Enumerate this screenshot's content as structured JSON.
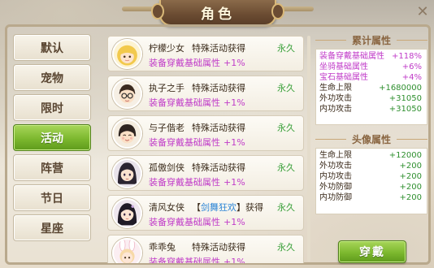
{
  "window": {
    "title": "角色"
  },
  "tabs": [
    {
      "label": "默认"
    },
    {
      "label": "宠物"
    },
    {
      "label": "限时"
    },
    {
      "label": "活动",
      "active": true
    },
    {
      "label": "阵营"
    },
    {
      "label": "节日"
    },
    {
      "label": "星座"
    }
  ],
  "titles": [
    {
      "name": "柠檬少女",
      "method": "特殊活动获得",
      "duration": "永久",
      "effect": "装备穿戴基础属性",
      "value": "+1%"
    },
    {
      "name": "执子之手",
      "method": "特殊活动获得",
      "duration": "永久",
      "effect": "装备穿戴基础属性",
      "value": "+1%"
    },
    {
      "name": "与子偕老",
      "method": "特殊活动获得",
      "duration": "永久",
      "effect": "装备穿戴基础属性",
      "value": "+1%"
    },
    {
      "name": "孤傲剑侠",
      "method": "特殊活动获得",
      "duration": "永久",
      "effect": "装备穿戴基础属性",
      "value": "+1%"
    },
    {
      "name": "清风女侠",
      "method_prefix": "【",
      "method_highlight": "剑舞狂欢",
      "method_suffix": "】获得",
      "duration": "永久",
      "effect": "装备穿戴基础属性",
      "value": "+1%"
    },
    {
      "name": "乖乖兔",
      "method": "特殊活动获得",
      "duration": "永久",
      "effect": "装备穿戴基础属性",
      "value": "+1%"
    }
  ],
  "accumulated": {
    "heading": "累计属性",
    "stats": [
      {
        "label": "装备穿戴基础属性",
        "value": "+118%",
        "color": "purple"
      },
      {
        "label": "坐骑基础属性",
        "value": "+6%",
        "color": "purple"
      },
      {
        "label": "宝石基础属性",
        "value": "+4%",
        "color": "purple"
      },
      {
        "label": "生命上限",
        "value": "+1680000"
      },
      {
        "label": "外功攻击",
        "value": "+31050"
      },
      {
        "label": "内功攻击",
        "value": "+31050"
      }
    ]
  },
  "avatar_attrs": {
    "heading": "头像属性",
    "stats": [
      {
        "label": "生命上限",
        "value": "+12000"
      },
      {
        "label": "外功攻击",
        "value": "+200"
      },
      {
        "label": "内功攻击",
        "value": "+200"
      },
      {
        "label": "外功防御",
        "value": "+200"
      },
      {
        "label": "内功防御",
        "value": "+200"
      }
    ]
  },
  "actions": {
    "equip_label": "穿戴"
  },
  "colors": {
    "accent_green": "#7cb82e",
    "purple_text": "#c03bc8",
    "value_green": "#2e8f2e",
    "link_blue": "#2e86d6"
  }
}
